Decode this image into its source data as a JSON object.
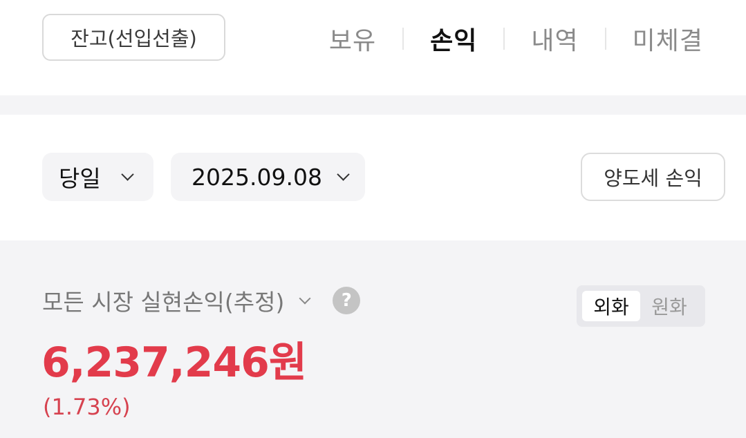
{
  "header": {
    "balance_button": "잔고(선입선출)",
    "tabs": [
      {
        "label": "보유",
        "active": false
      },
      {
        "label": "손익",
        "active": true
      },
      {
        "label": "내역",
        "active": false
      },
      {
        "label": "미체결",
        "active": false
      }
    ]
  },
  "filters": {
    "period": "당일",
    "date": "2025.09.08",
    "tax_button": "양도세 손익"
  },
  "summary": {
    "title": "모든 시장 실현손익(추정)",
    "help_icon": "?",
    "currency_options": [
      "외화",
      "원화"
    ],
    "currency_selected": "외화",
    "amount": "6,237,246원",
    "rate": "(1.73%)"
  },
  "colors": {
    "profit_red": "#e23b4b",
    "background_gray": "#f4f4f6"
  }
}
